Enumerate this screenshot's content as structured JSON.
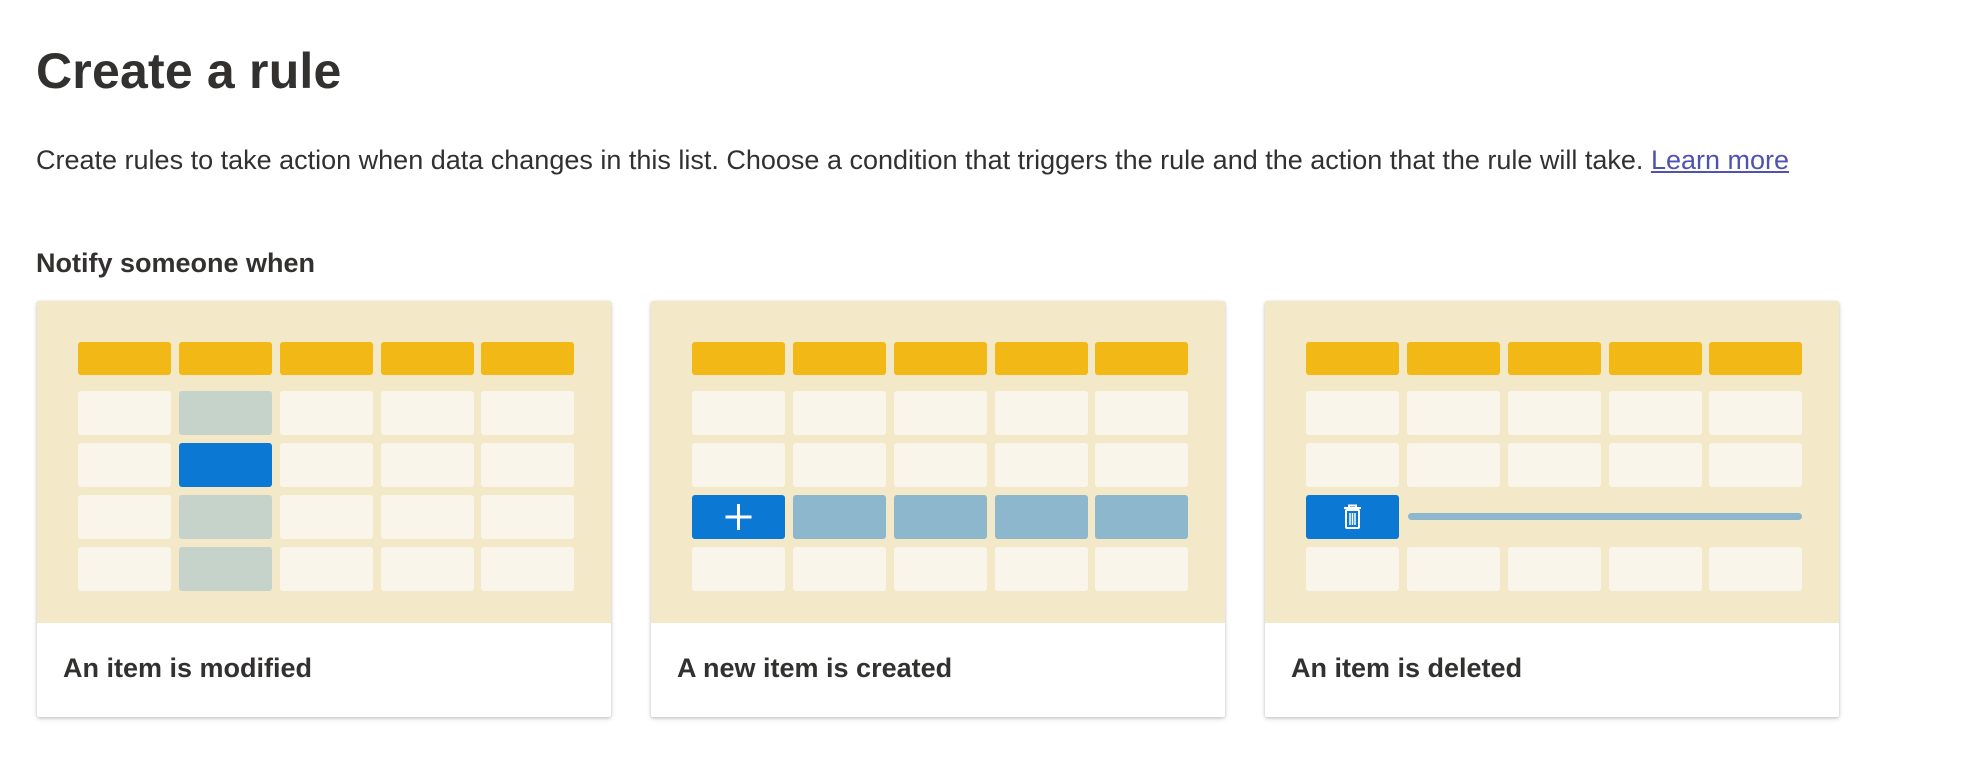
{
  "header": {
    "title": "Create a rule",
    "description": "Create rules to take action when data changes in this list. Choose a condition that triggers the rule and the action that the rule will take. ",
    "learn_more_label": "Learn more"
  },
  "section": {
    "label": "Notify someone when"
  },
  "cards": [
    {
      "label": "An item is modified",
      "icon": "table-cell-modified-illustration"
    },
    {
      "label": "A new item is created",
      "icon": "plus-icon"
    },
    {
      "label": "An item is deleted",
      "icon": "trash-icon"
    }
  ],
  "colors": {
    "illustration_bg": "#f3e8c8",
    "header_cell": "#f2b816",
    "cell": "#faf5ea",
    "accent_blue": "#0b78d4",
    "highlight_row": "#8cb7cc",
    "selected_column": "#c5d3cb",
    "link": "#4f52b2"
  }
}
